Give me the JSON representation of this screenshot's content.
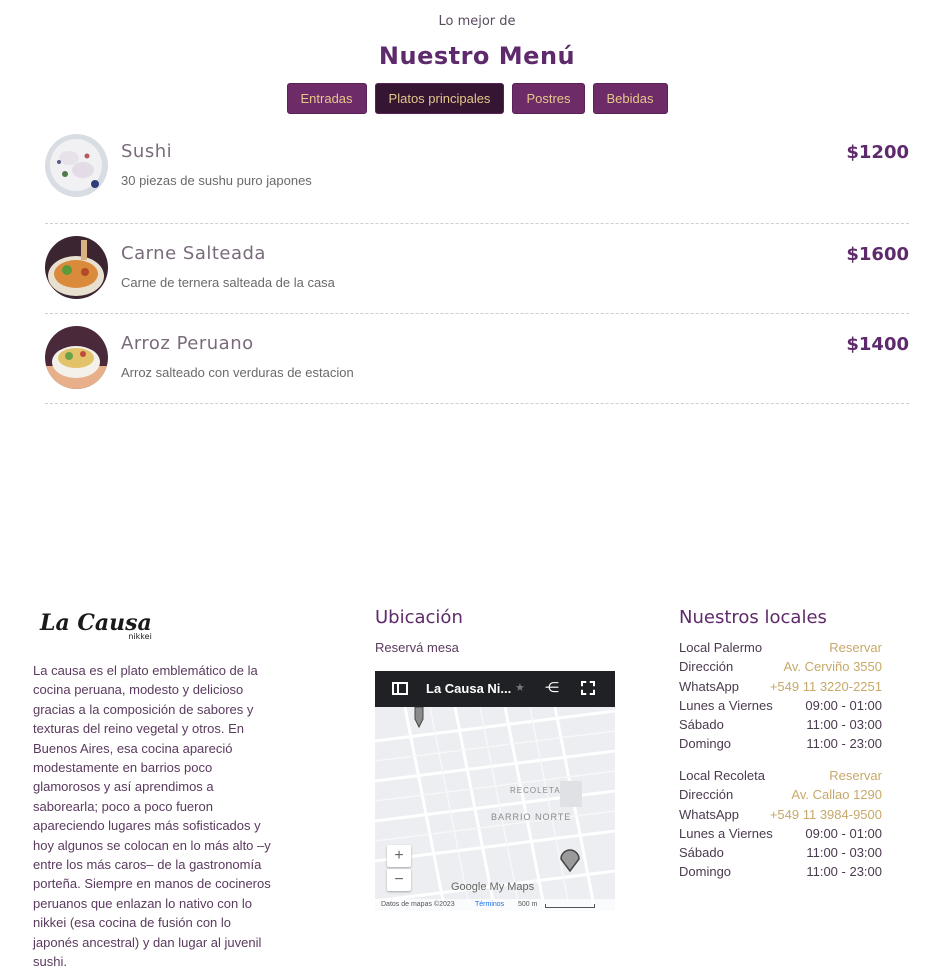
{
  "header": {
    "subtitle": "Lo mejor de",
    "title": "Nuestro Menú"
  },
  "tabs": [
    {
      "label": "Entradas",
      "active": false
    },
    {
      "label": "Platos principales",
      "active": true
    },
    {
      "label": "Postres",
      "active": false
    },
    {
      "label": "Bebidas",
      "active": false
    }
  ],
  "menu": [
    {
      "name": "Sushi",
      "description": "30 piezas de sushu puro japones",
      "price": "$1200"
    },
    {
      "name": "Carne Salteada",
      "description": "Carne de ternera salteada de la casa",
      "price": "$1600"
    },
    {
      "name": "Arroz Peruano",
      "description": "Arroz salteado con verduras de estacion",
      "price": "$1400"
    }
  ],
  "footer": {
    "logo_text": "La Causa",
    "logo_sub": "nikkei",
    "about": "La causa es el plato emblemático de la cocina peruana, modesto y delicioso gracias a la composición de sabores y texturas del reino vegetal y otros. En Buenos Aires, esa cocina apareció modestamente en barrios poco glamorosos y así aprendimos a saborearla; poco a poco fueron apareciendo lugares más sofisticados y hoy algunos se colocan en lo más alto –y entre los más caros– de la gastronomía porteña. Siempre en manos de cocineros peruanos que enlazan lo nativo con lo nikkei (esa cocina de fusión con lo japonés ancestral) y dan lugar al juvenil sushi.",
    "location_title": "Ubicación",
    "reserve_text": "Reservá mesa",
    "map": {
      "title": "La Causa Ni...",
      "area_label_1": "RECOLETA",
      "area_label_2": "BARRIO NORTE",
      "zoom_in": "+",
      "zoom_out": "−",
      "brand": "Google My Maps",
      "attribution": "Datos de mapas ©2023",
      "terms": "Términos",
      "scale": "500 m"
    },
    "branches_title": "Nuestros locales",
    "branches": [
      {
        "name": "Local Palermo",
        "reserve": "Reservar",
        "address_label": "Dirección",
        "address": "Av. Cerviño 3550",
        "whatsapp_label": "WhatsApp",
        "whatsapp": "+549 11 3220-2251",
        "hours": [
          {
            "day": "Lunes a Viernes",
            "time": "09:00 - 01:00"
          },
          {
            "day": "Sábado",
            "time": "11:00 - 03:00"
          },
          {
            "day": "Domingo",
            "time": "11:00 - 23:00"
          }
        ]
      },
      {
        "name": "Local Recoleta",
        "reserve": "Reservar",
        "address_label": "Dirección",
        "address": "Av. Callao 1290",
        "whatsapp_label": "WhatsApp",
        "whatsapp": "+549 11 3984-9500",
        "hours": [
          {
            "day": "Lunes a Viernes",
            "time": "09:00 - 01:00"
          },
          {
            "day": "Sábado",
            "time": "11:00 - 03:00"
          },
          {
            "day": "Domingo",
            "time": "11:00 - 23:00"
          }
        ]
      }
    ]
  },
  "colors": {
    "brand_purple": "#5e2a6b",
    "tab_bg": "#6d2c68",
    "tab_active_bg": "#341532",
    "gold": "#c6a96a"
  }
}
